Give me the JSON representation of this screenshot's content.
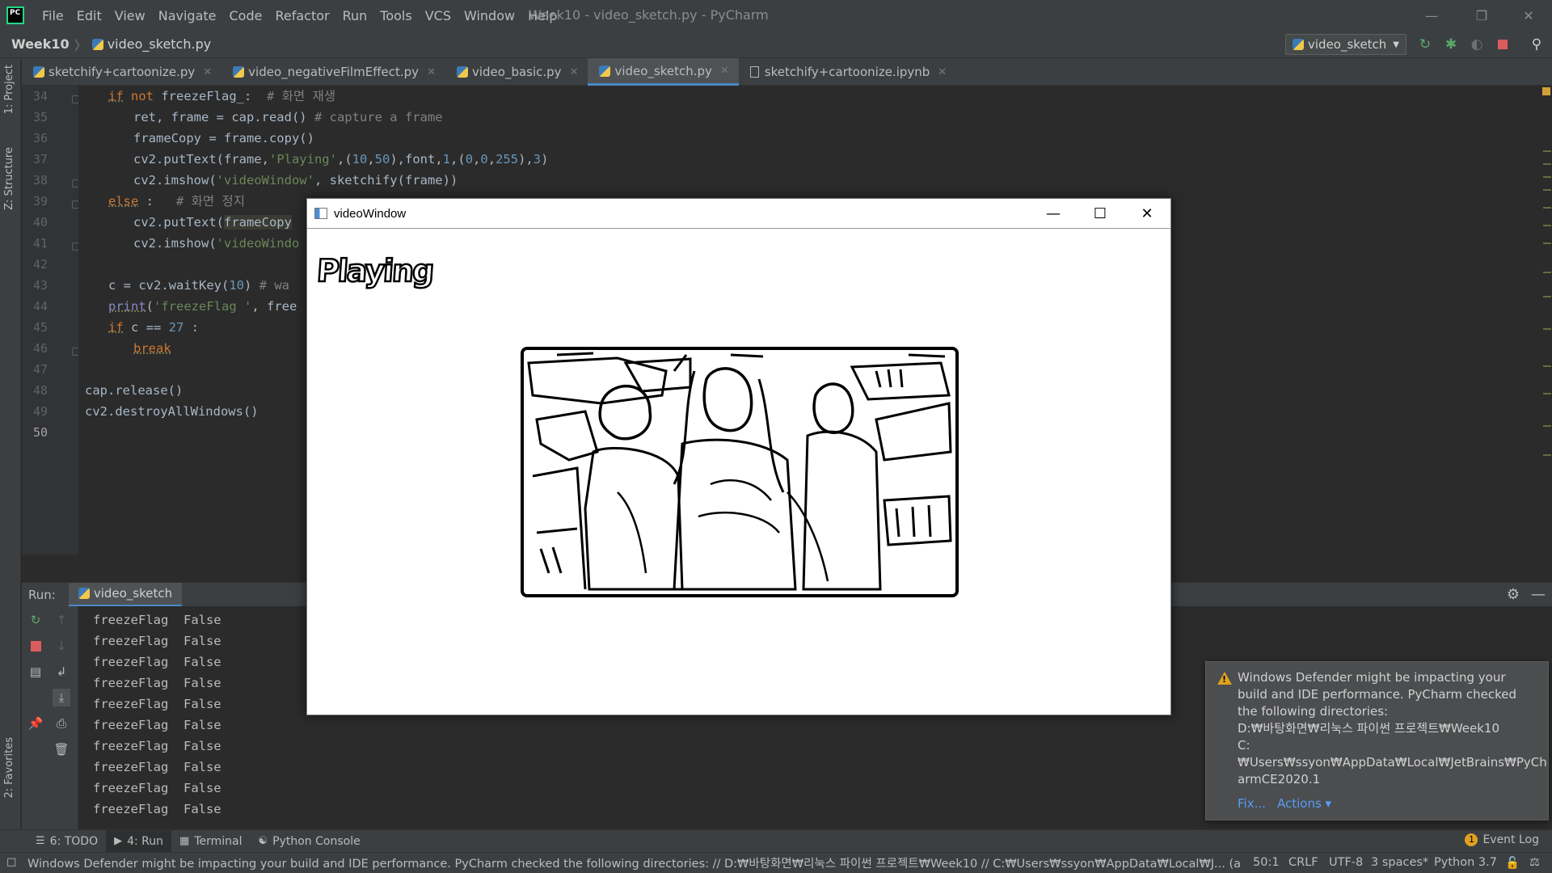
{
  "app": {
    "window_title": "Week10 - video_sketch.py - PyCharm",
    "menu": [
      "File",
      "Edit",
      "View",
      "Navigate",
      "Code",
      "Refactor",
      "Run",
      "Tools",
      "VCS",
      "Window",
      "Help"
    ]
  },
  "navbar": {
    "project": "Week10",
    "file": "video_sketch.py",
    "run_config": "video_sketch"
  },
  "left_strip": {
    "project_tab": "1: Project",
    "structure_tab": "Z: Structure",
    "favorites_tab": "2: Favorites"
  },
  "tabs": [
    {
      "label": "sketchify+cartoonize.py",
      "type": "py",
      "active": false
    },
    {
      "label": "video_negativeFilmEffect.py",
      "type": "py",
      "active": false
    },
    {
      "label": "video_basic.py",
      "type": "py",
      "active": false
    },
    {
      "label": "video_sketch.py",
      "type": "py",
      "active": true
    },
    {
      "label": "sketchify+cartoonize.ipynb",
      "type": "ipynb",
      "active": false
    }
  ],
  "editor": {
    "line_numbers": [
      "34",
      "35",
      "36",
      "37",
      "38",
      "39",
      "40",
      "41",
      "42",
      "43",
      "44",
      "45",
      "46",
      "47",
      "48",
      "49",
      "50"
    ],
    "current_line": "50",
    "code": {
      "l34_kw1": "if",
      "l34_kw2": "not",
      "l34_rest": " freezeFlag_:  ",
      "l34_cm": "# 화면 재생",
      "l35": "ret, frame = cap.read()",
      "l35_cm": " # capture a frame",
      "l36": "frameCopy = frame.copy()",
      "l37_a": "cv2.putText(frame,",
      "l37_str": "'Playing'",
      "l37_b": ",(",
      "l37_n1": "10",
      "l37_c": ",",
      "l37_n2": "50",
      "l37_d": "),font,",
      "l37_n3": "1",
      "l37_e": ",(",
      "l37_n4": "0",
      "l37_f": ",",
      "l37_n5": "0",
      "l37_g": ",",
      "l37_n6": "255",
      "l37_h": "),",
      "l37_n7": "3",
      "l37_i": ")",
      "l38_a": "cv2.imshow(",
      "l38_str": "'videoWindow'",
      "l38_b": ", sketchify(frame))",
      "l39_kw": "else",
      "l39_rest": " :   ",
      "l39_cm": "# 화면 정지",
      "l40_a": "cv2.putText(",
      "l40_hl": "frameCopy",
      "l41_a": "cv2.imshow(",
      "l41_str": "'videoWindo",
      "l43_a": "c = cv2.waitKey(",
      "l43_n": "10",
      "l43_b": ") ",
      "l43_cm": "# wa",
      "l44_a": "print",
      "l44_b": "(",
      "l44_str": "'freezeFlag '",
      "l44_c": ", free",
      "l45_kw": "if",
      "l45_a": " c == ",
      "l45_n": "27",
      "l45_b": " :",
      "l46_kw": "break",
      "l48": "cap.release()",
      "l49": "cv2.destroyAllWindows()"
    }
  },
  "run_panel": {
    "label": "Run:",
    "tab": "video_sketch",
    "output": [
      "freezeFlag  False",
      "freezeFlag  False",
      "freezeFlag  False",
      "freezeFlag  False",
      "freezeFlag  False",
      "freezeFlag  False",
      "freezeFlag  False",
      "freezeFlag  False",
      "freezeFlag  False",
      "freezeFlag  False"
    ]
  },
  "video_window": {
    "title": "videoWindow",
    "overlay_text": "Playing"
  },
  "notification": {
    "lines": [
      "Windows Defender might be impacting your",
      "build and IDE performance. PyCharm checked",
      "the following directories:",
      "D:₩바탕화면₩리눅스 파이썬 프로젝트₩Week10",
      "C:",
      "₩Users₩ssyon₩AppData₩Local₩JetBrains₩PyCh",
      "armCE2020.1"
    ],
    "fix_label": "Fix...",
    "actions_label": "Actions ▾"
  },
  "bottom_tabs": {
    "todo": "6: TODO",
    "run": "4: Run",
    "terminal": "Terminal",
    "python_console": "Python Console",
    "event_log": "Event Log",
    "event_count": "1"
  },
  "statusbar": {
    "message": "Windows Defender might be impacting your build and IDE performance. PyCharm checked the following directories: // D:₩바탕화면₩리눅스 파이썬 프로젝트₩Week10 // C:₩Users₩ssyon₩AppData₩Local₩J... (a minute ag",
    "position": "50:1",
    "line_sep": "CRLF",
    "encoding": "UTF-8",
    "indent": "3 spaces*",
    "interpreter": "Python 3.7"
  },
  "colors": {
    "keyword": "#cc7832",
    "string": "#6a8759",
    "number": "#6897bb",
    "comment": "#808080",
    "run_green": "#59a869",
    "stop_red": "#db5c5c",
    "accent": "#4a88c7"
  }
}
